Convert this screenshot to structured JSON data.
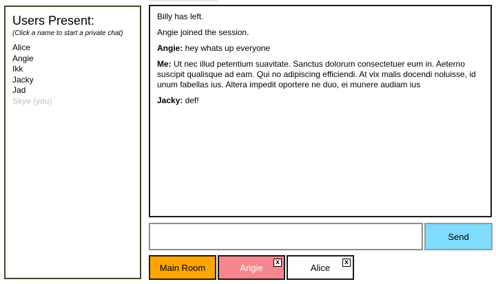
{
  "users_panel": {
    "title": "Users Present:",
    "hint": "(Click a name to start a private chat)",
    "users": [
      "Alice",
      "Angie",
      "Ikk",
      "Jacky",
      "Jad"
    ],
    "self_user": "Skye (you)"
  },
  "chat": {
    "messages": [
      {
        "sender": "",
        "text": "Billy has left."
      },
      {
        "sender": "",
        "text": "Angie joined the session."
      },
      {
        "sender": "Angie:",
        "text": " hey whats up everyone"
      },
      {
        "sender": "Me:",
        "text": " Ut nec illud petentium suavitate. Sanctus dolorum consectetuer eum in. Aeterno suscipit qualisque ad eam. Qui no adipiscing efficiendi. At vix malis docendi noluisse, id unum fabellas ius. Altera impedit oportere ne duo, ei munere audiam ius"
      },
      {
        "sender": "Jacky:",
        "text": " def!"
      }
    ]
  },
  "composer": {
    "input_value": "",
    "send_label": "Send"
  },
  "tabs": [
    {
      "label": "Main Room",
      "closable": false,
      "color": "#ffa500"
    },
    {
      "label": "Angie",
      "closable": true,
      "color": "#f7878f"
    },
    {
      "label": "Alice",
      "closable": true,
      "color": "#ffffff"
    }
  ],
  "close_glyph": "x"
}
